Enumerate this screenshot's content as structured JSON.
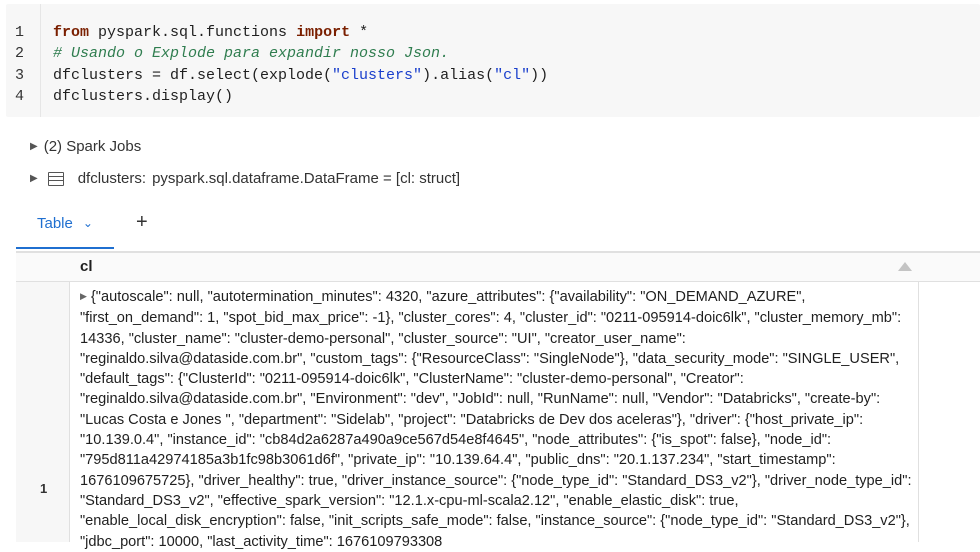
{
  "code_cell": {
    "line_numbers": [
      "1",
      "2",
      "3",
      "4"
    ],
    "line1": {
      "kw1": "from",
      "mid": " pyspark.sql.functions ",
      "kw2": "import",
      "end": " *"
    },
    "line2": "# Usando o Explode para expandir nosso Json.",
    "line3": {
      "pre": "dfclusters = df.select(explode(",
      "str1": "\"clusters\"",
      "mid": ").alias(",
      "str2": "\"cl\"",
      "end": "))"
    },
    "line4": "dfclusters.display()"
  },
  "spark_jobs": {
    "label": "(2) Spark Jobs"
  },
  "dataframe_info": {
    "name": "dfclusters:",
    "type": "pyspark.sql.dataframe.DataFrame = [cl: struct]"
  },
  "result_tabs": {
    "table_label": "Table",
    "add_label": "+"
  },
  "table": {
    "column_header": "cl",
    "row_number": "1",
    "cell_value": "{\"autoscale\": null, \"autotermination_minutes\": 4320, \"azure_attributes\": {\"availability\": \"ON_DEMAND_AZURE\", \"first_on_demand\": 1, \"spot_bid_max_price\": -1}, \"cluster_cores\": 4, \"cluster_id\": \"0211-095914-doic6lk\", \"cluster_memory_mb\": 14336, \"cluster_name\": \"cluster-demo-personal\", \"cluster_source\": \"UI\", \"creator_user_name\": \"reginaldo.silva@dataside.com.br\", \"custom_tags\": {\"ResourceClass\": \"SingleNode\"}, \"data_security_mode\": \"SINGLE_USER\", \"default_tags\": {\"ClusterId\": \"0211-095914-doic6lk\", \"ClusterName\": \"cluster-demo-personal\", \"Creator\": \"reginaldo.silva@dataside.com.br\", \"Environment\": \"dev\", \"JobId\": null, \"RunName\": null, \"Vendor\": \"Databricks\", \"create-by\": \"Lucas Costa e Jones \", \"department\": \"Sidelab\", \"project\": \"Databricks de Dev dos aceleras\"}, \"driver\": {\"host_private_ip\": \"10.139.0.4\", \"instance_id\": \"cb84d2a6287a490a9ce567d54e8f4645\", \"node_attributes\": {\"is_spot\": false}, \"node_id\": \"795d811a42974185a3b1fc98b3061d6f\", \"private_ip\": \"10.139.64.4\", \"public_dns\": \"20.1.137.234\", \"start_timestamp\": 1676109675725}, \"driver_healthy\": true, \"driver_instance_source\": {\"node_type_id\": \"Standard_DS3_v2\"}, \"driver_node_type_id\": \"Standard_DS3_v2\", \"effective_spark_version\": \"12.1.x-cpu-ml-scala2.12\", \"enable_elastic_disk\": true, \"enable_local_disk_encryption\": false, \"init_scripts_safe_mode\": false, \"instance_source\": {\"node_type_id\": \"Standard_DS3_v2\"}, \"jdbc_port\": 10000, \"last_activity_time\": 1676109793308"
  },
  "colors": {
    "accent": "#1f6fd0",
    "keyword": "#7a1f00",
    "comment": "#2f7d4f",
    "string": "#1a3fcc"
  }
}
